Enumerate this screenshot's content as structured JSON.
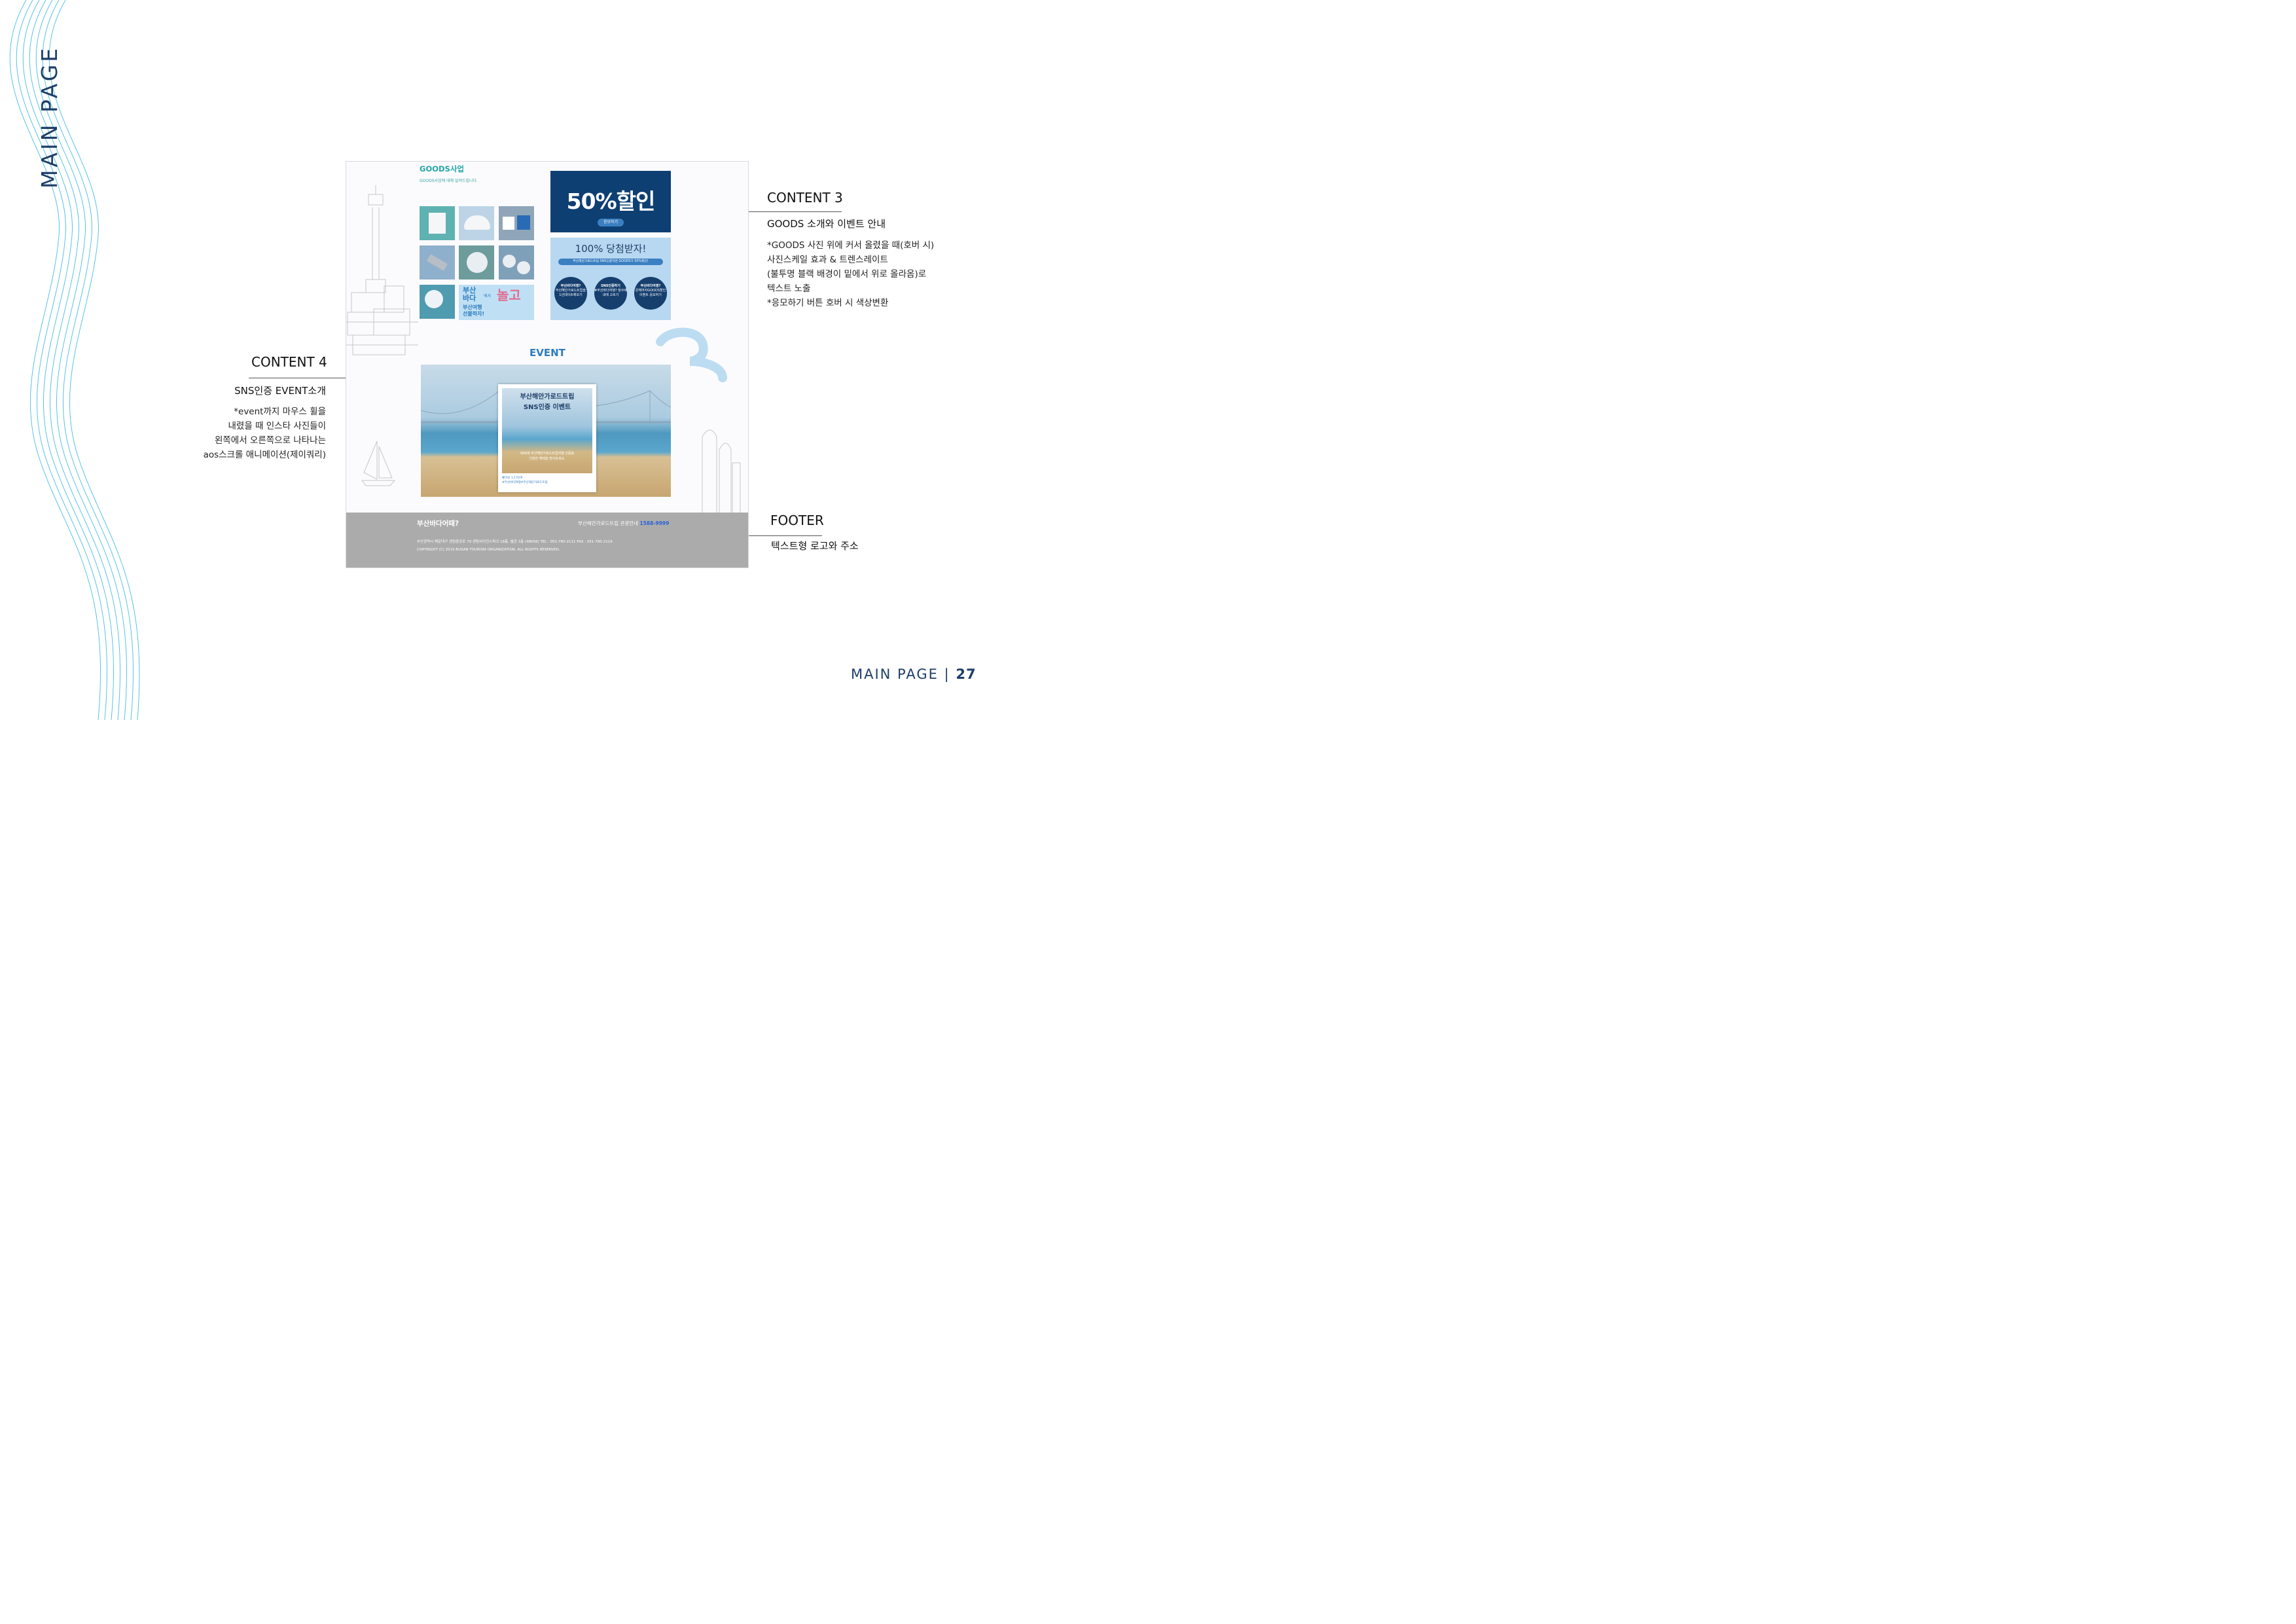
{
  "vertical_title": "MAIN PAGE",
  "annotations": {
    "content3": {
      "title": "CONTENT 3",
      "subtitle": "GOODS 소개와 이벤트  안내",
      "lines": [
        "*GOODS 사진 위에 커서 올렸을 때(호버 시)",
        "사진스케일 효과 & 트렌스레이트",
        "(불투명 블랙 배경이 밑에서 위로 올라옴)로",
        "텍스트 노출",
        "*응모하기 버튼 호버 시 색상변환"
      ]
    },
    "content4": {
      "title": "CONTENT 4",
      "subtitle": "SNS인증 EVENT소개",
      "lines": [
        "*event까지 마우스 휠을",
        "내렸을 때 인스타 사진들이",
        "왼쪽에서 오른쪽으로 나타나는",
        "aos스크롤 애니메이션(제이쿼리)"
      ]
    },
    "footer": {
      "title": "FOOTER",
      "subtitle": "텍스트형 로고와 주소"
    }
  },
  "mockup": {
    "goods": {
      "title": "GOODS사업",
      "subtitle": "GOODS사업에 대해 알려드립니다.",
      "banner_lines": [
        "부산",
        "바다",
        "에서",
        "놀고",
        "부산여행",
        "선물하자!"
      ]
    },
    "promo": {
      "headline": "50%할인",
      "button": "응모하기",
      "subheadline": "100% 당첨받자!",
      "ribbon": "부산해안가로드트립 SNS인증하면 GOODS가 50%할인!",
      "circles": [
        {
          "title": "부산바다여행?",
          "text": "부산해안가로드트립을 1년데이트해보기"
        },
        {
          "title": "SNS인증하기",
          "text": "#부산바다여행? 정수배내에 고르기"
        },
        {
          "title": "부산바다여행?",
          "text": "온해여자GOODS할인 이벤트 응모하기"
        }
      ]
    },
    "event": {
      "title": "EVENT",
      "card_title": [
        "부산해안가로드트립",
        "SNS인증 이벤트"
      ],
      "card_text": [
        "SNS에 부산해안가로드트립여행 인증을",
        "다양한 혜택을 받아보세요."
      ],
      "card_meta": [
        "좋아요 1,170개",
        "#부산바다여행#부산해안가로드트립"
      ]
    },
    "footer": {
      "logo": "부산바다어때?",
      "contact_label": "부산해안가로드트립 관광안내",
      "phone": "1588-9999",
      "address": "부산광역시 해운대구 센텀중앙로 79 센텀사이언스파크 18층, 별관 3층 (48058) TEL : 051-780-2111 FAX : 051-780-2119",
      "copyright": "COPYRIGHT (C) 2019 BUSAN TOURISM ORGANIZATION. ALL RIGHTS RESERVED."
    }
  },
  "page_number": {
    "label": "MAIN PAGE",
    "separator": "|",
    "number": "27"
  },
  "colors": {
    "navy": "#1e3e69",
    "teal": "#23a4a6",
    "wave": "#56c3e8",
    "footer_gray": "#ababab",
    "phone_blue": "#2b62d6"
  }
}
